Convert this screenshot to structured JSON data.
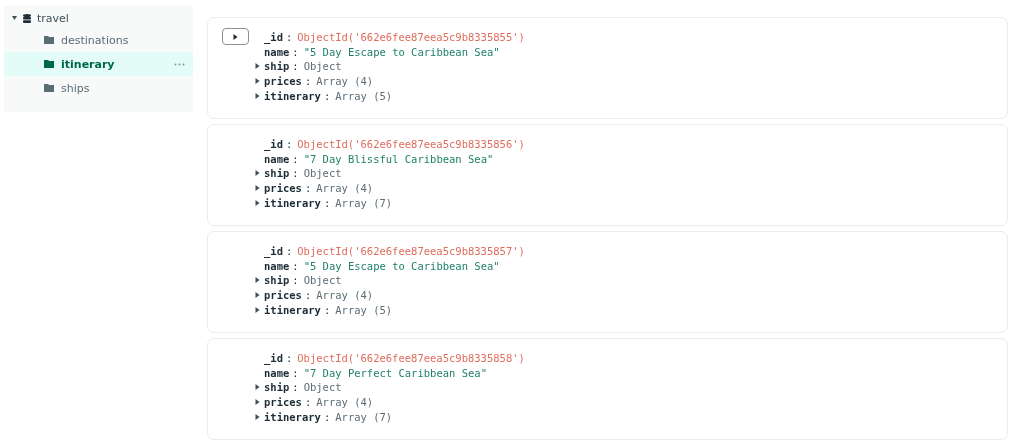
{
  "sidebar": {
    "database": {
      "name": "travel",
      "expanded": true
    },
    "collections": [
      {
        "name": "destinations",
        "selected": false
      },
      {
        "name": "itinerary",
        "selected": true
      },
      {
        "name": "ships",
        "selected": false
      }
    ]
  },
  "documents": [
    {
      "expand_button": true,
      "fields": [
        {
          "key": "_id",
          "sep": ":",
          "kind": "id",
          "value": "ObjectId('662e6fee87eea5c9b8335855')"
        },
        {
          "key": "name",
          "sep": ":",
          "kind": "string",
          "value": "\"5 Day Escape to Caribbean Sea\""
        },
        {
          "key": "ship",
          "sep": ":",
          "kind": "object",
          "value": "Object",
          "expanded": false
        },
        {
          "key": "prices",
          "sep": ":",
          "kind": "object",
          "value": "Array (4)",
          "expanded": false
        },
        {
          "key": "itinerary",
          "sep": ":",
          "kind": "object",
          "value": "Array (5)",
          "expanded": false
        }
      ]
    },
    {
      "expand_button": false,
      "fields": [
        {
          "key": "_id",
          "sep": ":",
          "kind": "id",
          "value": "ObjectId('662e6fee87eea5c9b8335856')"
        },
        {
          "key": "name",
          "sep": ":",
          "kind": "string",
          "value": "\"7 Day Blissful Caribbean Sea\""
        },
        {
          "key": "ship",
          "sep": ":",
          "kind": "object",
          "value": "Object",
          "expanded": false
        },
        {
          "key": "prices",
          "sep": ":",
          "kind": "object",
          "value": "Array (4)",
          "expanded": false
        },
        {
          "key": "itinerary",
          "sep": ":",
          "kind": "object",
          "value": "Array (7)",
          "expanded": false
        }
      ]
    },
    {
      "expand_button": false,
      "fields": [
        {
          "key": "_id",
          "sep": ":",
          "kind": "id",
          "value": "ObjectId('662e6fee87eea5c9b8335857')"
        },
        {
          "key": "name",
          "sep": ":",
          "kind": "string",
          "value": "\"5 Day Escape to Caribbean Sea\""
        },
        {
          "key": "ship",
          "sep": ":",
          "kind": "object",
          "value": "Object",
          "expanded": false
        },
        {
          "key": "prices",
          "sep": ":",
          "kind": "object",
          "value": "Array (4)",
          "expanded": false
        },
        {
          "key": "itinerary",
          "sep": ":",
          "kind": "object",
          "value": "Array (5)",
          "expanded": false
        }
      ]
    },
    {
      "expand_button": false,
      "fields": [
        {
          "key": "_id",
          "sep": ":",
          "kind": "id",
          "value": "ObjectId('662e6fee87eea5c9b8335858')"
        },
        {
          "key": "name",
          "sep": ":",
          "kind": "string",
          "value": "\"7 Day Perfect Caribbean Sea\""
        },
        {
          "key": "ship",
          "sep": ":",
          "kind": "object",
          "value": "Object",
          "expanded": false
        },
        {
          "key": "prices",
          "sep": ":",
          "kind": "object",
          "value": "Array (4)",
          "expanded": false
        },
        {
          "key": "itinerary",
          "sep": ":",
          "kind": "object",
          "value": "Array (7)",
          "expanded": false
        }
      ]
    }
  ]
}
